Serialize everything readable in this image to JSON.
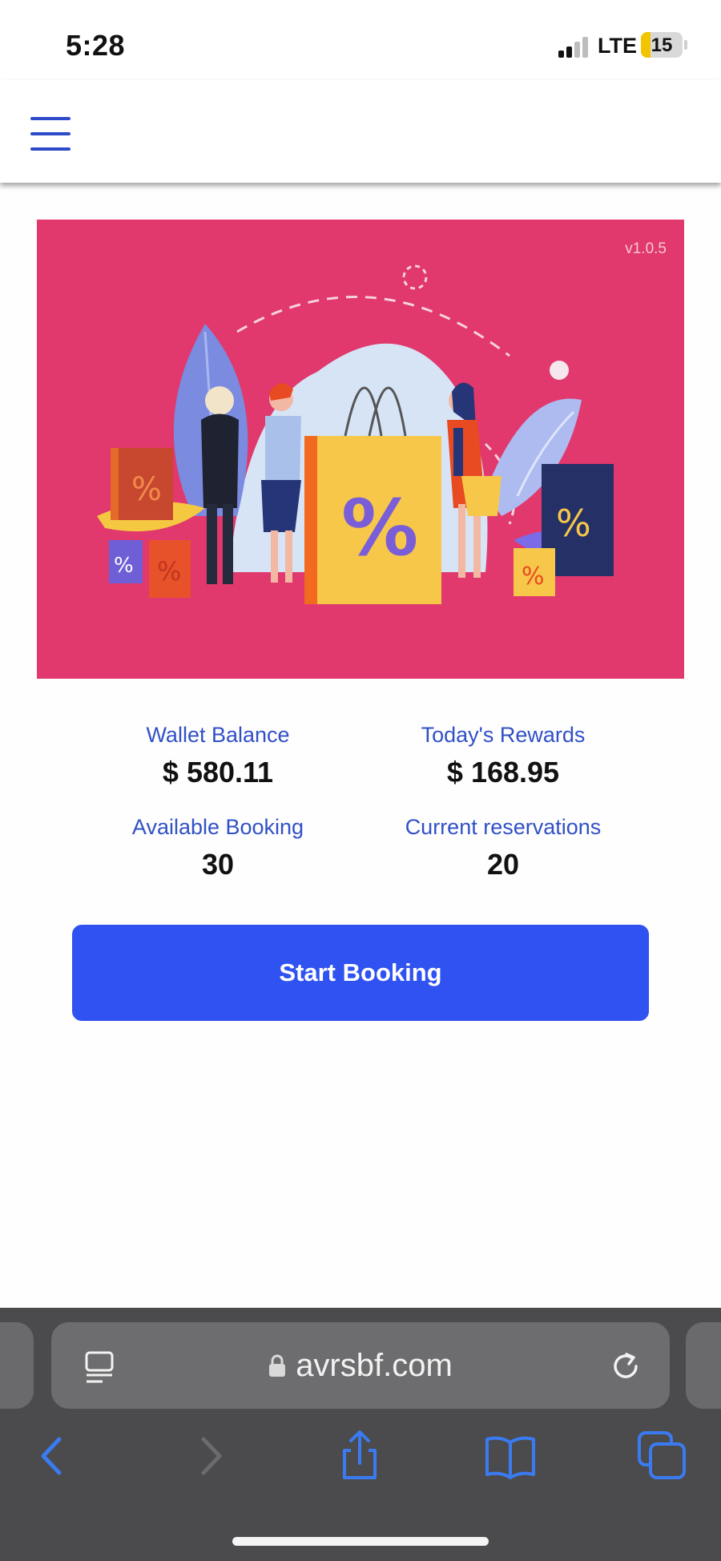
{
  "status_bar": {
    "time": "5:28",
    "network": "LTE",
    "battery": "15"
  },
  "header": {
    "menu_icon": "hamburger-menu-icon"
  },
  "banner": {
    "version": "v1.0.5",
    "illustration": "shopping-people-illustration",
    "background_color": "#e1386d"
  },
  "stats": {
    "wallet_balance_label": "Wallet Balance",
    "wallet_balance_value": "$ 580.11",
    "todays_rewards_label": "Today's Rewards",
    "todays_rewards_value": "$ 168.95",
    "available_booking_label": "Available Booking",
    "available_booking_value": "30",
    "current_reservations_label": "Current reservations",
    "current_reservations_value": "20"
  },
  "actions": {
    "start_booking": "Start Booking"
  },
  "browser": {
    "url": "avrsbf.com",
    "accent_color": "#3a7bf2"
  }
}
